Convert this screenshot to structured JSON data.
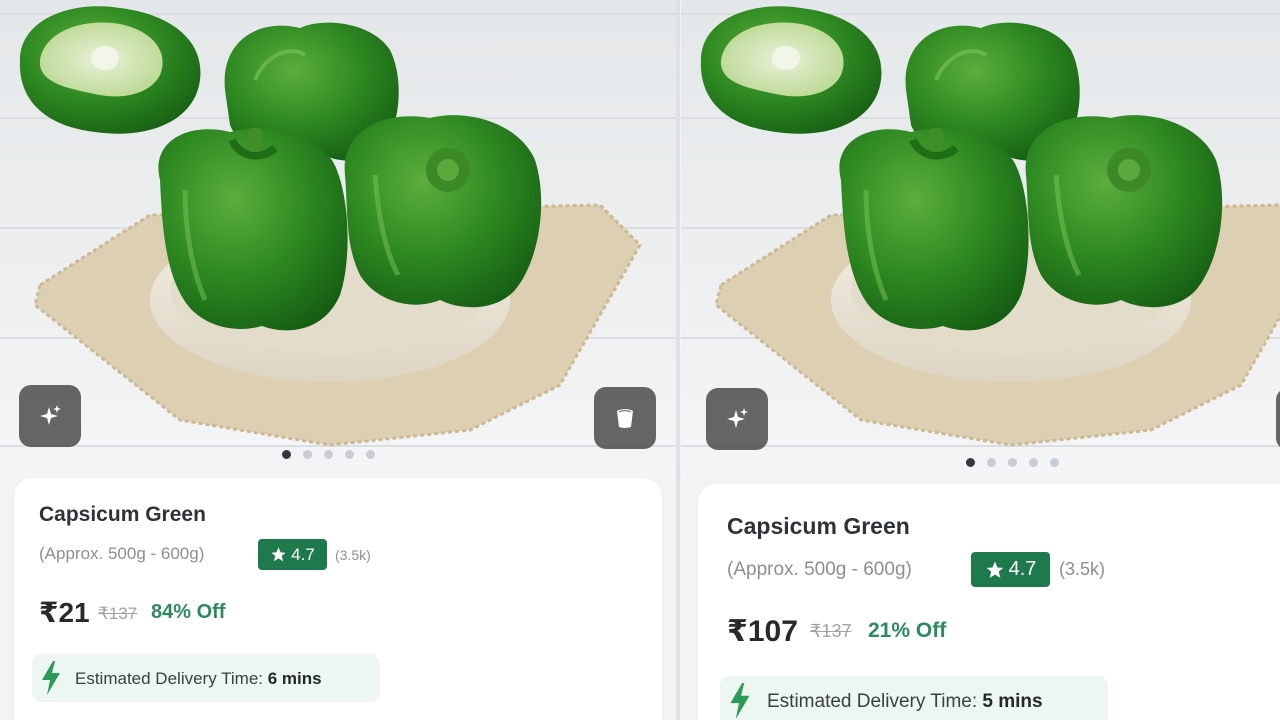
{
  "colors": {
    "accent_green": "#1e7a4c",
    "discount_green": "#2c8a5e",
    "button_bg": "#4b4b4b"
  },
  "panels": [
    {
      "product": {
        "name": "Capsicum Green",
        "weight": "(Approx. 500g - 600g)",
        "rating": "4.7",
        "rating_count": "(3.5k)",
        "price": "₹21",
        "mrp": "₹137",
        "discount": "84% Off"
      },
      "delivery": {
        "label": "Estimated Delivery Time:",
        "time": "6 mins"
      },
      "icons": {
        "left_button": "sparkle-icon",
        "right_button": "ar-view-icon",
        "delivery": "lightning-bolt-icon",
        "rating": "star-icon"
      },
      "carousel": {
        "count": 5,
        "active_index": 0
      }
    },
    {
      "product": {
        "name": "Capsicum Green",
        "weight": "(Approx. 500g - 600g)",
        "rating": "4.7",
        "rating_count": "(3.5k)",
        "price": "₹107",
        "mrp": "₹137",
        "discount": "21% Off"
      },
      "delivery": {
        "label": "Estimated Delivery Time:",
        "time": "5 mins"
      },
      "icons": {
        "left_button": "sparkle-icon",
        "delivery": "lightning-bolt-icon",
        "rating": "star-icon"
      },
      "carousel": {
        "count": 5,
        "active_index": 0
      }
    }
  ]
}
